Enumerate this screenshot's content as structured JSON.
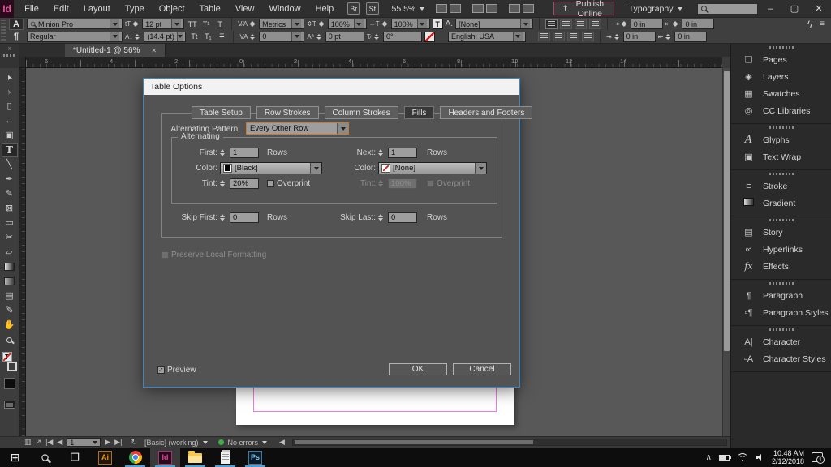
{
  "menubar": {
    "logo": "Id",
    "menus": [
      "File",
      "Edit",
      "Layout",
      "Type",
      "Object",
      "Table",
      "View",
      "Window",
      "Help"
    ],
    "bridge_button": "Br",
    "stock_button": "St",
    "zoom_level": "55.5%",
    "publish_button": "Publish Online",
    "workspace": "Typography"
  },
  "window_controls": {
    "minimize": "–",
    "maximize": "▢",
    "close": "✕"
  },
  "control_panel": {
    "character_icon": "A",
    "paragraph_icon": "¶",
    "font_name": "Minion Pro",
    "font_style": "Regular",
    "size_icon": "tT",
    "leading_icon": "A↕",
    "font_size": "12 pt",
    "leading": "(14.4 pt)",
    "all_caps": "TT",
    "superscript": "T¹",
    "underline": "T",
    "small_caps": "Tt",
    "subscript": "T₁",
    "strikethrough": "T",
    "kerning_icon": "V∕A",
    "tracking_icon": "VA",
    "kerning": "Metrics",
    "tracking": "0",
    "vscale_icon": "⇕T",
    "hscale_icon": "⇔T",
    "baseline_icon": "Aª",
    "skew_icon": "T∕",
    "vertical_scale": "100%",
    "horizontal_scale": "100%",
    "baseline_shift": "0 pt",
    "skew": "0°",
    "fill_chip": "T",
    "character_style_label": "A.",
    "character_style": "[None]",
    "language": "English: USA",
    "indent_left_icon": "⇥",
    "indent_right_icon": "⇤",
    "indent_left": "0 in",
    "indent_right": "0 in",
    "indent_first": "0 in",
    "indent_last": "0 in",
    "flash_icon": "ϟ",
    "panel_menu_icon": "≡"
  },
  "document": {
    "tab_title": "*Untitled-1 @ 56%",
    "close_glyph": "✕",
    "dock_chevrons": "»",
    "ruler_labels": [
      "6",
      "4",
      "2",
      "0",
      "2",
      "4",
      "6",
      "8",
      "10",
      "12",
      "14"
    ]
  },
  "tools": [
    {
      "name": "selection-tool",
      "glyph": "➤",
      "cls": "rotNW"
    },
    {
      "name": "direct-selection-tool",
      "glyph": "➢",
      "cls": "rotNW dim"
    },
    {
      "name": "page-tool",
      "glyph": "▯"
    },
    {
      "name": "gap-tool",
      "glyph": "↔"
    },
    {
      "name": "content-collector-tool",
      "glyph": "▣"
    },
    {
      "name": "type-tool",
      "glyph": "T",
      "selected": true,
      "cls": "serifT"
    },
    {
      "name": "line-tool",
      "glyph": "╲"
    },
    {
      "name": "pen-tool",
      "glyph": "✒"
    },
    {
      "name": "pencil-tool",
      "glyph": "✎"
    },
    {
      "name": "rectangle-frame-tool",
      "glyph": "⊠"
    },
    {
      "name": "rectangle-tool",
      "glyph": "▭"
    },
    {
      "name": "scissors-tool",
      "glyph": "✂"
    },
    {
      "name": "free-transform-tool",
      "glyph": "▱"
    },
    {
      "name": "gradient-swatch-tool",
      "gradient": true
    },
    {
      "name": "gradient-feather-tool",
      "gradient": true,
      "cls": "feather"
    },
    {
      "name": "note-tool",
      "glyph": "▤"
    },
    {
      "name": "eyedropper-tool",
      "glyph": "✐",
      "cls": "flip"
    },
    {
      "name": "hand-tool",
      "glyph": "✋"
    },
    {
      "name": "zoom-tool",
      "mag": true
    }
  ],
  "dialog": {
    "title": "Table Options",
    "tabs": [
      "Table Setup",
      "Row Strokes",
      "Column Strokes",
      "Fills",
      "Headers and Footers"
    ],
    "active_tab": "Fills",
    "pattern_label": "Alternating Pattern:",
    "pattern_value": "Every Other Row",
    "group_label": "Alternating",
    "first_label": "First:",
    "first_value": "1",
    "next_label": "Next:",
    "next_value": "1",
    "rows_label": "Rows",
    "color_label": "Color:",
    "fill_color_1": "[Black]",
    "fill_color_2": "[None]",
    "tint_label": "Tint:",
    "tint_1": "20%",
    "tint_2": "100%",
    "overprint_label": "Overprint",
    "skip_first_label": "Skip First:",
    "skip_first_value": "0",
    "skip_last_label": "Skip Last:",
    "skip_last_value": "0",
    "preserve_label": "Preserve Local Formatting",
    "preview_label": "Preview",
    "ok_label": "OK",
    "cancel_label": "Cancel"
  },
  "right_panel": {
    "groups": [
      {
        "items": [
          {
            "icon": "pages-icon",
            "glyph": "❏",
            "label": "Pages"
          },
          {
            "icon": "layers-icon",
            "glyph": "◈",
            "label": "Layers"
          },
          {
            "icon": "swatches-icon",
            "glyph": "▦",
            "label": "Swatches"
          },
          {
            "icon": "cc-libraries-icon",
            "glyph": "◎",
            "label": "CC Libraries"
          }
        ]
      },
      {
        "items": [
          {
            "icon": "glyphs-icon",
            "glyph": "A",
            "label": "Glyphs",
            "cls": "serifA"
          },
          {
            "icon": "text-wrap-icon",
            "glyph": "▣",
            "label": "Text Wrap"
          }
        ]
      },
      {
        "items": [
          {
            "icon": "stroke-icon",
            "glyph": "≡",
            "label": "Stroke"
          },
          {
            "icon": "gradient-icon",
            "label": "Gradient",
            "gradient": true
          }
        ]
      },
      {
        "items": [
          {
            "icon": "story-icon",
            "glyph": "▤",
            "label": "Story"
          },
          {
            "icon": "hyperlinks-icon",
            "glyph": "∞",
            "label": "Hyperlinks"
          },
          {
            "icon": "effects-icon",
            "glyph": "fx",
            "label": "Effects",
            "cls": "fx"
          }
        ]
      },
      {
        "items": [
          {
            "icon": "paragraph-icon",
            "glyph": "¶",
            "label": "Paragraph"
          },
          {
            "icon": "paragraph-styles-icon",
            "glyph": "▫¶",
            "label": "Paragraph Styles"
          }
        ]
      },
      {
        "items": [
          {
            "icon": "character-icon",
            "glyph": "A|",
            "label": "Character"
          },
          {
            "icon": "character-styles-icon",
            "glyph": "▫A",
            "label": "Character Styles"
          }
        ]
      }
    ]
  },
  "statusbar": {
    "page_number": "1",
    "preflight_profile": "[Basic] (working)",
    "preflight_status": "No errors"
  },
  "taskbar": {
    "apps": [
      {
        "id": "illustrator",
        "label": "Ai",
        "running": false
      },
      {
        "id": "chrome",
        "label": "",
        "running": true
      },
      {
        "id": "indesign",
        "label": "Id",
        "running": true,
        "active": true
      },
      {
        "id": "file-explorer",
        "label": "",
        "running": true
      },
      {
        "id": "fax-scan",
        "label": "",
        "running": true
      },
      {
        "id": "photoshop",
        "label": "Ps",
        "running": true
      }
    ],
    "time": "10:48 AM",
    "date": "2/12/2018",
    "notification_count": "1"
  },
  "colors": {
    "dialog_focus_border": "#3a87c8",
    "selection_orange": "#c87d2e",
    "guide_pink": "#f07ae6",
    "status_green": "#3fae49",
    "logo_pink": "#e0559a",
    "taskbar_indicator": "#4e9fd4",
    "publish_border": "#a04a66"
  }
}
